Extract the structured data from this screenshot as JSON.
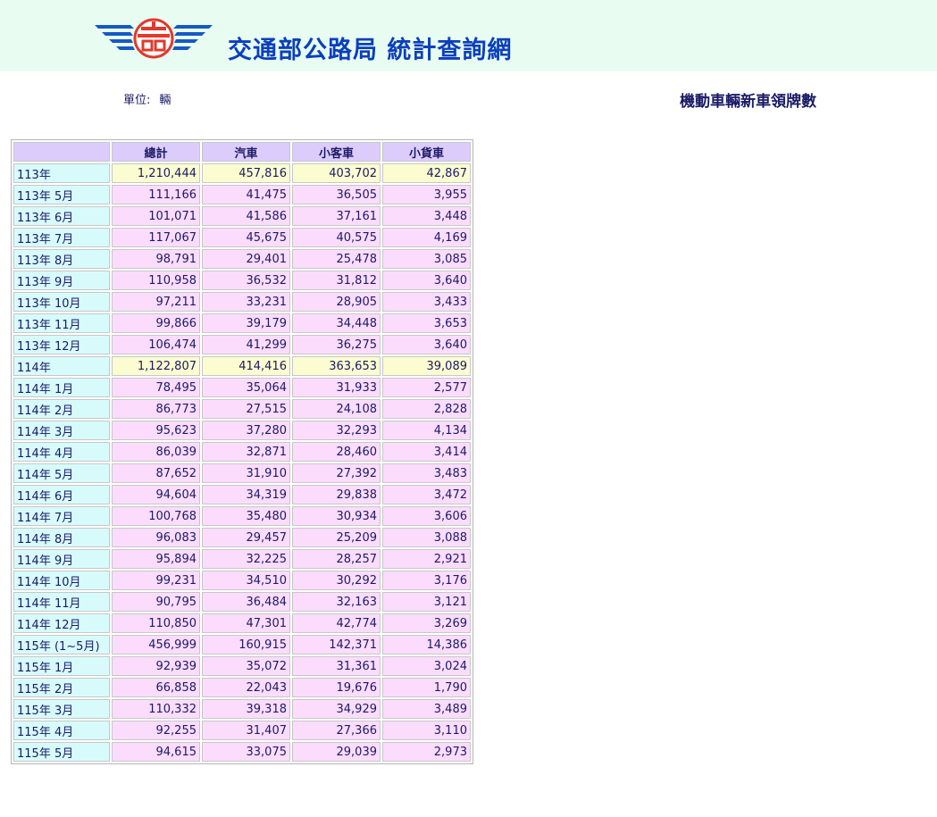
{
  "header": {
    "site_title": "交通部公路局 統計查詢網",
    "logo_icon": "highway-bureau-logo",
    "colors": {
      "title": "#0b3fbd",
      "logo_blue": "#1559c4",
      "logo_red": "#e03a2c",
      "band": "#e8fcf2"
    }
  },
  "unit": {
    "label": "單位:",
    "value": "輛"
  },
  "report_title": "機動車輛新車領牌數",
  "table": {
    "headers": [
      "",
      "總計",
      "汽車",
      "小客車",
      "小貨車"
    ],
    "rows": [
      {
        "period": "113年",
        "annual": true,
        "values": [
          "1,210,444",
          "457,816",
          "403,702",
          "42,867"
        ]
      },
      {
        "period": "113年 5月",
        "annual": false,
        "values": [
          "111,166",
          "41,475",
          "36,505",
          "3,955"
        ]
      },
      {
        "period": "113年 6月",
        "annual": false,
        "values": [
          "101,071",
          "41,586",
          "37,161",
          "3,448"
        ]
      },
      {
        "period": "113年 7月",
        "annual": false,
        "values": [
          "117,067",
          "45,675",
          "40,575",
          "4,169"
        ]
      },
      {
        "period": "113年 8月",
        "annual": false,
        "values": [
          "98,791",
          "29,401",
          "25,478",
          "3,085"
        ]
      },
      {
        "period": "113年 9月",
        "annual": false,
        "values": [
          "110,958",
          "36,532",
          "31,812",
          "3,640"
        ]
      },
      {
        "period": "113年 10月",
        "annual": false,
        "values": [
          "97,211",
          "33,231",
          "28,905",
          "3,433"
        ]
      },
      {
        "period": "113年 11月",
        "annual": false,
        "values": [
          "99,866",
          "39,179",
          "34,448",
          "3,653"
        ]
      },
      {
        "period": "113年 12月",
        "annual": false,
        "values": [
          "106,474",
          "41,299",
          "36,275",
          "3,640"
        ]
      },
      {
        "period": "114年",
        "annual": true,
        "values": [
          "1,122,807",
          "414,416",
          "363,653",
          "39,089"
        ]
      },
      {
        "period": "114年 1月",
        "annual": false,
        "values": [
          "78,495",
          "35,064",
          "31,933",
          "2,577"
        ]
      },
      {
        "period": "114年 2月",
        "annual": false,
        "values": [
          "86,773",
          "27,515",
          "24,108",
          "2,828"
        ]
      },
      {
        "period": "114年 3月",
        "annual": false,
        "values": [
          "95,623",
          "37,280",
          "32,293",
          "4,134"
        ]
      },
      {
        "period": "114年 4月",
        "annual": false,
        "values": [
          "86,039",
          "32,871",
          "28,460",
          "3,414"
        ]
      },
      {
        "period": "114年 5月",
        "annual": false,
        "values": [
          "87,652",
          "31,910",
          "27,392",
          "3,483"
        ]
      },
      {
        "period": "114年 6月",
        "annual": false,
        "values": [
          "94,604",
          "34,319",
          "29,838",
          "3,472"
        ]
      },
      {
        "period": "114年 7月",
        "annual": false,
        "values": [
          "100,768",
          "35,480",
          "30,934",
          "3,606"
        ]
      },
      {
        "period": "114年 8月",
        "annual": false,
        "values": [
          "96,083",
          "29,457",
          "25,209",
          "3,088"
        ]
      },
      {
        "period": "114年 9月",
        "annual": false,
        "values": [
          "95,894",
          "32,225",
          "28,257",
          "2,921"
        ]
      },
      {
        "period": "114年 10月",
        "annual": false,
        "values": [
          "99,231",
          "34,510",
          "30,292",
          "3,176"
        ]
      },
      {
        "period": "114年 11月",
        "annual": false,
        "values": [
          "90,795",
          "36,484",
          "32,163",
          "3,121"
        ]
      },
      {
        "period": "114年 12月",
        "annual": false,
        "values": [
          "110,850",
          "47,301",
          "42,774",
          "3,269"
        ]
      },
      {
        "period": "115年 (1~5月)",
        "annual": false,
        "values": [
          "456,999",
          "160,915",
          "142,371",
          "14,386"
        ]
      },
      {
        "period": "115年 1月",
        "annual": false,
        "values": [
          "92,939",
          "35,072",
          "31,361",
          "3,024"
        ]
      },
      {
        "period": "115年 2月",
        "annual": false,
        "values": [
          "66,858",
          "22,043",
          "19,676",
          "1,790"
        ]
      },
      {
        "period": "115年 3月",
        "annual": false,
        "values": [
          "110,332",
          "39,318",
          "34,929",
          "3,489"
        ]
      },
      {
        "period": "115年 4月",
        "annual": false,
        "values": [
          "92,255",
          "31,407",
          "27,366",
          "3,110"
        ]
      },
      {
        "period": "115年 5月",
        "annual": false,
        "values": [
          "94,615",
          "33,075",
          "29,039",
          "2,973"
        ]
      }
    ]
  }
}
